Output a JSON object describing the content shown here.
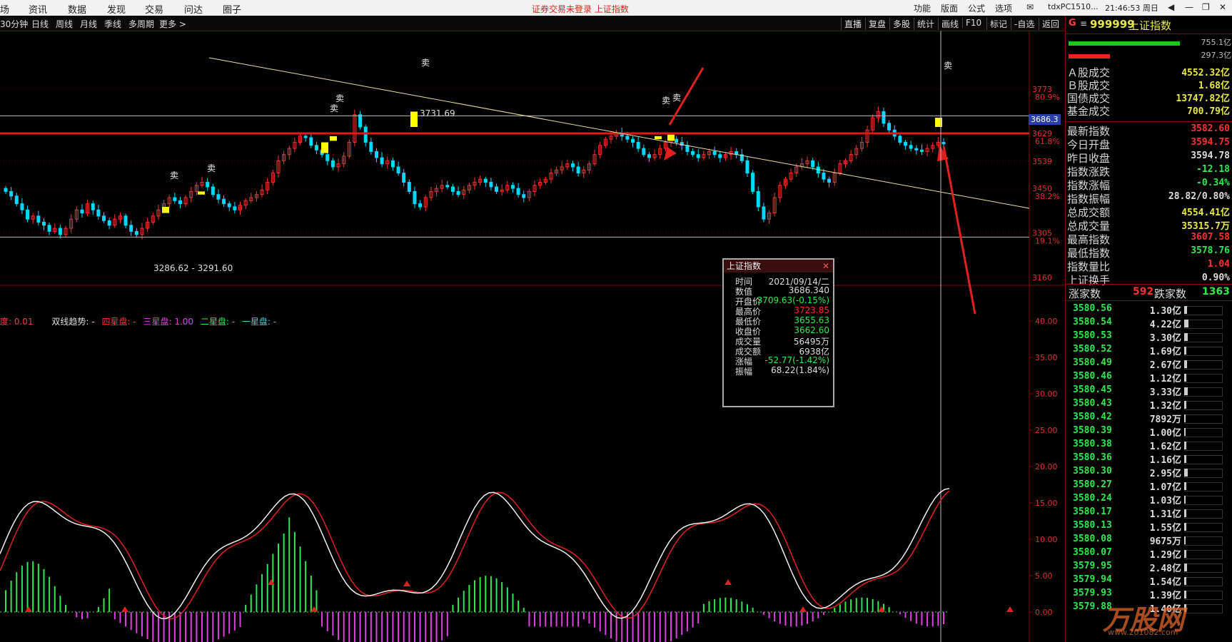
{
  "menu": {
    "items": [
      "场",
      "资讯",
      "数据",
      "发现",
      "交易",
      "问达",
      "圈子"
    ],
    "status": "证券交易未登录  上证指数",
    "right": [
      "功能",
      "版面",
      "公式",
      "选项"
    ],
    "host": "tdxPC1510...",
    "clock": "21:46:53 周日"
  },
  "periods": [
    "30分钟",
    "日线",
    "周线",
    "月线",
    "季线",
    "多周期",
    "更多 >"
  ],
  "toolbar_right": [
    "直播",
    "复盘",
    "多股",
    "统计",
    "画线",
    "F10",
    "标记",
    "-自选",
    "返回"
  ],
  "colors": {
    "up": "#ff3030",
    "down": "#00d8ff",
    "accent_red": "#e01818",
    "green": "#2fe84f",
    "magenta": "#e040e0",
    "yellow": "#ffff00"
  },
  "chart": {
    "price_axis": [
      {
        "v": 3773,
        "pct": "80.9%"
      },
      {
        "v": 3686.3,
        "pct": ""
      },
      {
        "v": 3629,
        "pct": "61.8%"
      },
      {
        "v": 3539,
        "pct": ""
      },
      {
        "v": 3450,
        "pct": "38.2%"
      },
      {
        "v": 3305,
        "pct": "19.1%"
      },
      {
        "v": 3160,
        "pct": ""
      }
    ],
    "crosshair_value": "3686.3",
    "high_label": "3731.69",
    "low_label": "3286.62 - 3291.60",
    "sell_mark": "卖",
    "indicator_legend": [
      {
        "text": "度: 0.01",
        "color": "#e04040"
      },
      {
        "text": "双线趋势: -",
        "color": "#dddddd"
      },
      {
        "text": "四星盘: -",
        "color": "#ff3030"
      },
      {
        "text": "三星盘: 1.00",
        "color": "#e040e0"
      },
      {
        "text": "二星盘: -",
        "color": "#2fe84f"
      },
      {
        "text": "一星盘: -",
        "color": "#40d0d0"
      }
    ],
    "indicator_axis": [
      "40.00",
      "35.00",
      "30.00",
      "25.00",
      "20.00",
      "15.00",
      "10.00",
      "5.00",
      "0.00"
    ]
  },
  "tooltip": {
    "title": "上证指数",
    "rows": [
      {
        "k": "时间",
        "v": "2021/09/14/二",
        "c": "#dddddd"
      },
      {
        "k": "数值",
        "v": "3686.340",
        "c": "#dddddd"
      },
      {
        "k": "开盘价",
        "v": "3709.63(-0.15%)",
        "c": "#2fe84f"
      },
      {
        "k": "最高价",
        "v": "3723.85",
        "c": "#ff3030"
      },
      {
        "k": "最低价",
        "v": "3655.63",
        "c": "#2fe84f"
      },
      {
        "k": "收盘价",
        "v": "3662.60",
        "c": "#2fe84f"
      },
      {
        "k": "成交量",
        "v": "56495万",
        "c": "#dddddd"
      },
      {
        "k": "成交额",
        "v": "6938亿",
        "c": "#dddddd"
      },
      {
        "k": "涨幅",
        "v": "-52.77(-1.42%)",
        "c": "#2fe84f"
      },
      {
        "k": "振幅",
        "v": "68.22(1.84%)",
        "c": "#dddddd"
      }
    ]
  },
  "panel": {
    "code": "999999",
    "name": "上证指数",
    "g_mark": "G",
    "bar_vals": [
      "755.1亿",
      "297.3亿"
    ],
    "stats1": [
      {
        "l": "Ａ股成交",
        "v": "4552.32亿",
        "c": "#e8e84a"
      },
      {
        "l": "Ｂ股成交",
        "v": "1.68亿",
        "c": "#e8e84a"
      },
      {
        "l": "国债成交",
        "v": "13747.82亿",
        "c": "#e8e84a"
      },
      {
        "l": "基金成交",
        "v": "700.79亿",
        "c": "#e8e84a"
      }
    ],
    "stats2": [
      {
        "l": "最新指数",
        "v": "3582.60",
        "c": "#ff3030"
      },
      {
        "l": "今日开盘",
        "v": "3594.75",
        "c": "#ff3030"
      },
      {
        "l": "昨日收盘",
        "v": "3594.78",
        "c": "#dddddd"
      },
      {
        "l": "指数涨跌",
        "v": "-12.18",
        "c": "#2fe84f"
      },
      {
        "l": "指数涨幅",
        "v": "-0.34%",
        "c": "#2fe84f"
      },
      {
        "l": "指数振幅",
        "v": "28.82/0.80%",
        "c": "#dddddd"
      },
      {
        "l": "总成交额",
        "v": "4554.41亿",
        "c": "#e8e84a"
      },
      {
        "l": "总成交量",
        "v": "35315.7万",
        "c": "#e8e84a"
      },
      {
        "l": "最高指数",
        "v": "3607.58",
        "c": "#ff3030"
      },
      {
        "l": "最低指数",
        "v": "3578.76",
        "c": "#2fe84f"
      },
      {
        "l": "指数量比",
        "v": "1.04",
        "c": "#ff3030"
      },
      {
        "l": "上证换手",
        "v": "0.90%",
        "c": "#dddddd"
      }
    ],
    "rise_label": "涨家数",
    "rise_count": "592",
    "fall_label": "跌家数",
    "fall_count": "1363",
    "ticks": [
      {
        "p": "3580.56",
        "v": "1.30亿",
        "w": 4
      },
      {
        "p": "3580.54",
        "v": "4.22亿",
        "w": 6
      },
      {
        "p": "3580.53",
        "v": "3.30亿",
        "w": 5
      },
      {
        "p": "3580.52",
        "v": "1.69亿",
        "w": 3
      },
      {
        "p": "3580.49",
        "v": "2.67亿",
        "w": 4
      },
      {
        "p": "3580.46",
        "v": "1.12亿",
        "w": 3
      },
      {
        "p": "3580.45",
        "v": "3.33亿",
        "w": 5
      },
      {
        "p": "3580.43",
        "v": "1.32亿",
        "w": 3
      },
      {
        "p": "3580.42",
        "v": "7892万",
        "w": 2
      },
      {
        "p": "3580.39",
        "v": "1.00亿",
        "w": 2
      },
      {
        "p": "3580.38",
        "v": "1.62亿",
        "w": 3
      },
      {
        "p": "3580.36",
        "v": "1.16亿",
        "w": 3
      },
      {
        "p": "3580.30",
        "v": "2.95亿",
        "w": 5
      },
      {
        "p": "3580.27",
        "v": "1.07亿",
        "w": 3
      },
      {
        "p": "3580.24",
        "v": "1.03亿",
        "w": 2
      },
      {
        "p": "3580.17",
        "v": "1.31亿",
        "w": 3
      },
      {
        "p": "3580.13",
        "v": "1.55亿",
        "w": 3
      },
      {
        "p": "3580.08",
        "v": "9675万",
        "w": 2
      },
      {
        "p": "3580.07",
        "v": "1.29亿",
        "w": 3
      },
      {
        "p": "3579.95",
        "v": "2.48亿",
        "w": 4
      },
      {
        "p": "3579.94",
        "v": "1.54亿",
        "w": 3
      },
      {
        "p": "3579.93",
        "v": "1.39亿",
        "w": 3
      },
      {
        "p": "3579.88",
        "v": "1.40亿",
        "w": 3
      }
    ]
  },
  "watermark": {
    "text": "万股网",
    "url": "www.201082.com"
  }
}
